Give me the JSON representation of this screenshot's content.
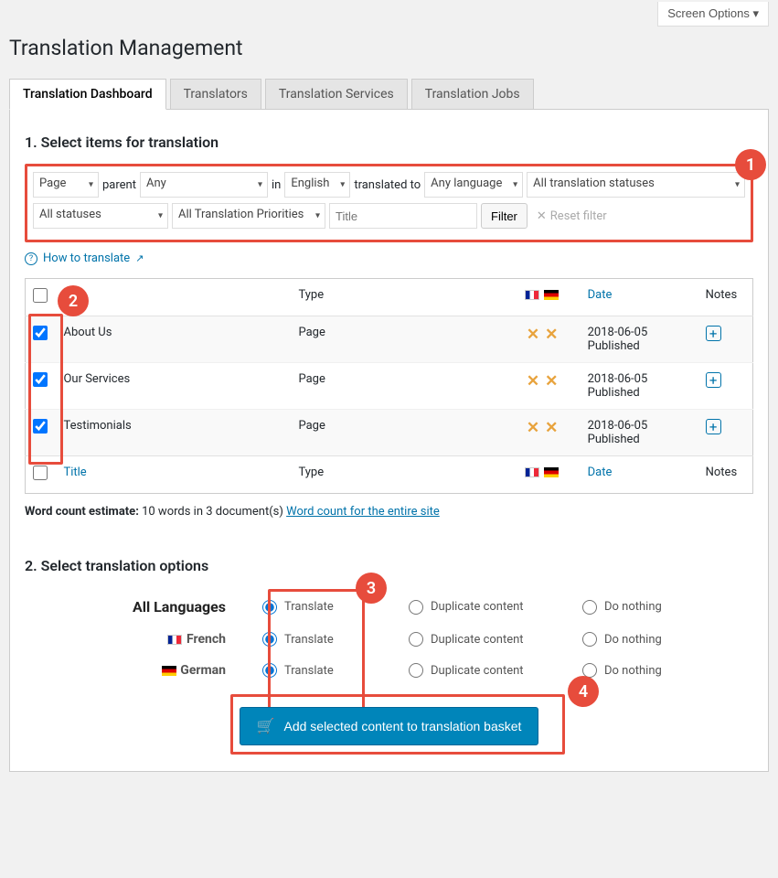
{
  "header": {
    "screen_options": "Screen Options",
    "page_title": "Translation Management"
  },
  "tabs": {
    "dashboard": "Translation Dashboard",
    "translators": "Translators",
    "services": "Translation Services",
    "jobs": "Translation Jobs"
  },
  "section1": {
    "title": "1. Select items for translation",
    "badge": "1",
    "badge2": "2",
    "filters": {
      "type": "Page",
      "parent_label": "parent",
      "parent": "Any",
      "in_label": "in",
      "language": "English",
      "translated_to_label": "translated to",
      "target": "Any language",
      "translation_status": "All translation statuses",
      "status": "All statuses",
      "priority": "All Translation Priorities",
      "title_placeholder": "Title",
      "filter_btn": "Filter",
      "reset": "Reset filter"
    },
    "how_to": "How to translate",
    "table": {
      "title": "Title",
      "type": "Type",
      "date": "Date",
      "notes": "Notes"
    },
    "rows": [
      {
        "title": "About Us",
        "type": "Page",
        "date": "2018-06-05",
        "status": "Published"
      },
      {
        "title": "Our Services",
        "type": "Page",
        "date": "2018-06-05",
        "status": "Published"
      },
      {
        "title": "Testimonials",
        "type": "Page",
        "date": "2018-06-05",
        "status": "Published"
      }
    ],
    "wordcount_label": "Word count estimate:",
    "wordcount_text": "10 words in 3 document(s)",
    "wordcount_link": "Word count for the entire site"
  },
  "section2": {
    "title": "2. Select translation options",
    "badge3": "3",
    "badge4": "4",
    "all_label": "All Languages",
    "french": "French",
    "german": "German",
    "opt_translate": "Translate",
    "opt_duplicate": "Duplicate content",
    "opt_nothing": "Do nothing",
    "button": "Add selected content to translation basket"
  }
}
